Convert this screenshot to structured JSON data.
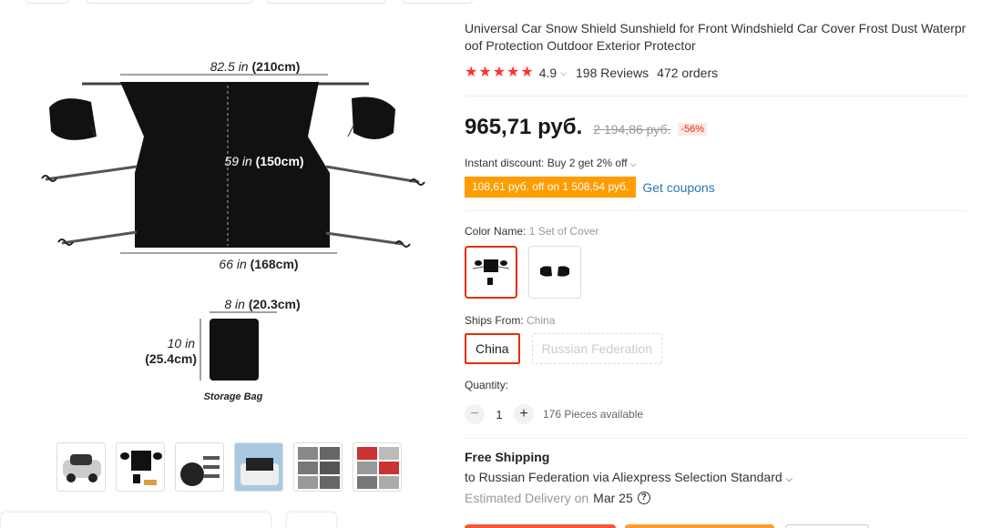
{
  "product": {
    "title": "Universal Car Snow Shield Sunshield for Front Windshield Car Cover Frost Dust Waterproof Protection Outdoor Exterior Protector",
    "rating": "4.9",
    "reviews": "198 Reviews",
    "orders": "472 orders",
    "stars": 5
  },
  "price": {
    "current": "965,71 руб.",
    "original": "2 194,86 руб.",
    "discount": "-56%"
  },
  "promo": {
    "instant_discount": "Instant discount: Buy 2 get 2% off",
    "coupon_tag": "108,61 руб. off on 1 508,54 руб.",
    "get_coupons": "Get coupons"
  },
  "color": {
    "label": "Color Name:",
    "value": "1 Set of Cover"
  },
  "ships_from": {
    "label": "Ships From:",
    "value": "China",
    "options": [
      "China",
      "Russian Federation"
    ]
  },
  "quantity": {
    "label": "Quantity:",
    "value": "1",
    "minus": "−",
    "plus": "+",
    "available": "176 Pieces available"
  },
  "shipping": {
    "title": "Free Shipping",
    "line": "to Russian Federation via Aliexpress Selection Standard",
    "delivery_label": "Estimated Delivery on",
    "delivery_date": "Mar 25"
  },
  "diagram": {
    "width_top": "82.5 in",
    "width_top_cm": "(210cm)",
    "height": "59 in",
    "height_cm": "(150cm)",
    "width_bottom": "66 in",
    "width_bottom_cm": "(168cm)",
    "bag_width": "8 in",
    "bag_width_cm": "(20.3cm)",
    "bag_height": "10 in",
    "bag_height_cm": "(25.4cm)",
    "bag_label": "Storage Bag"
  },
  "colors": {
    "accent": "#e62e04",
    "star": "#ff3333",
    "coupon": "#ff9d00",
    "link": "#2a7ab0"
  }
}
